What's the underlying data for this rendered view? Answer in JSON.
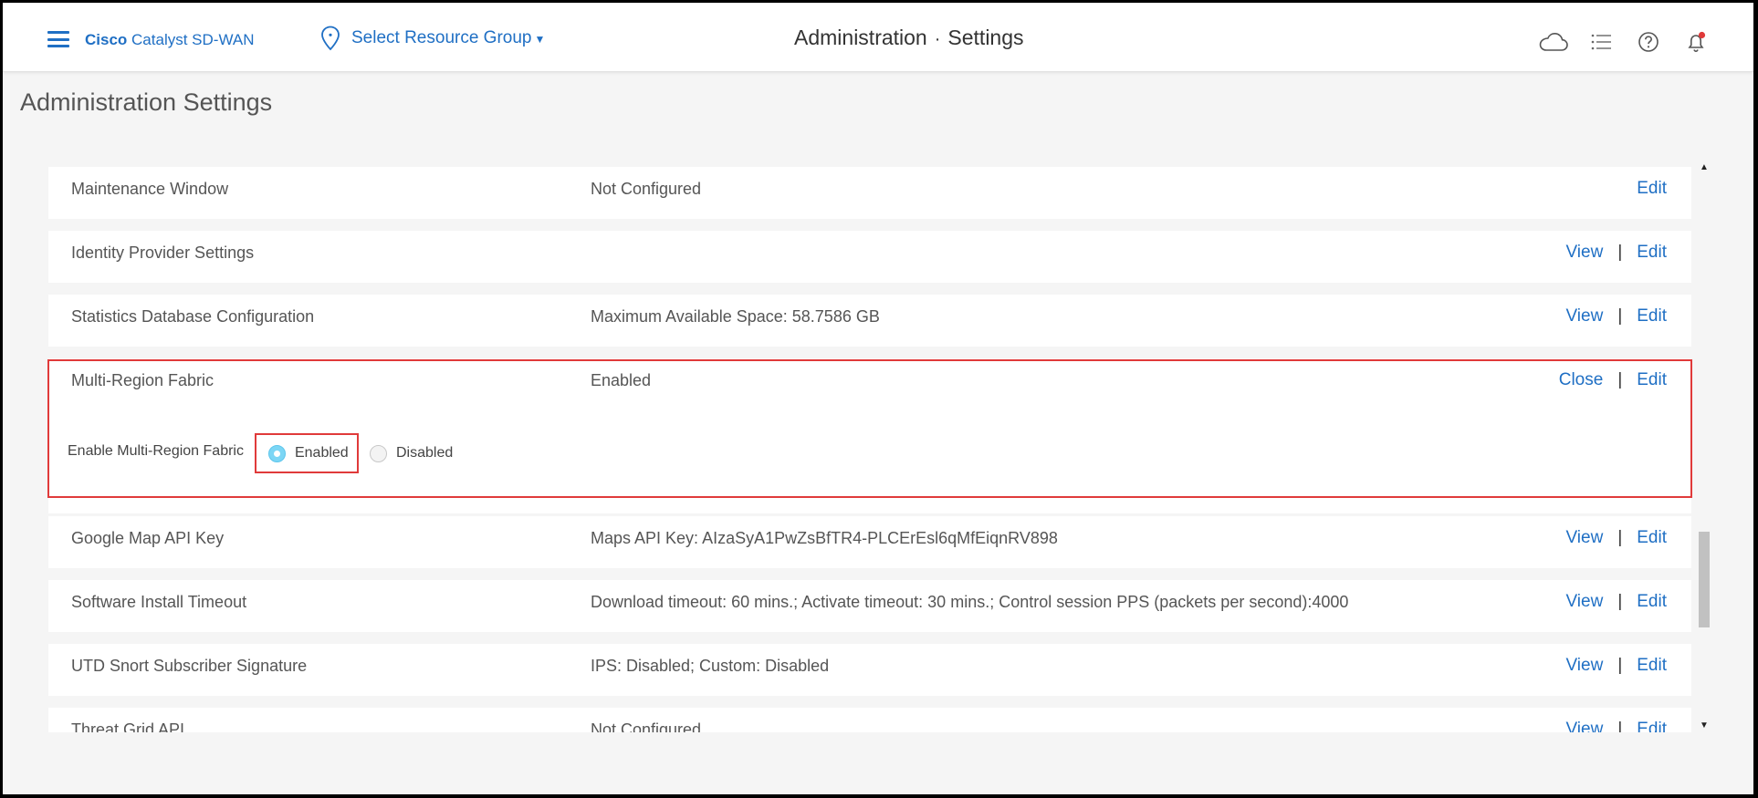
{
  "header": {
    "brand_bold": "Cisco",
    "brand_rest": "Catalyst SD-WAN",
    "resource_group": "Select Resource Group",
    "section": "Administration",
    "subsection": "Settings",
    "separator": "·",
    "icons": [
      "menu-icon",
      "location-pin-icon",
      "cloud-icon",
      "task-list-icon",
      "help-icon",
      "notification-bell-icon"
    ],
    "accent_color": "#1f6fc4",
    "notification_dot_color": "#e03a3a"
  },
  "page": {
    "title": "Administration Settings"
  },
  "settings": [
    {
      "name": "Maintenance Window",
      "value": "Not Configured",
      "actions": [
        "Edit"
      ]
    },
    {
      "name": "Identity Provider Settings",
      "value": "",
      "actions": [
        "View",
        "Edit"
      ]
    },
    {
      "name": "Statistics Database Configuration",
      "value": "Maximum Available Space: 58.7586 GB",
      "actions": [
        "View",
        "Edit"
      ]
    },
    {
      "name": "Multi-Region Fabric",
      "value": "Enabled",
      "actions": [
        "Close",
        "Edit"
      ],
      "expanded": {
        "option_label": "Enable Multi-Region Fabric",
        "options": [
          "Enabled",
          "Disabled"
        ],
        "selected": "Enabled"
      }
    },
    {
      "name": "Google Map API Key",
      "value": "Maps API Key: AIzaSyA1PwZsBfTR4-PLCErEsl6qMfEiqnRV898",
      "actions": [
        "View",
        "Edit"
      ]
    },
    {
      "name": "Software Install Timeout",
      "value": "Download timeout: 60 mins.; Activate timeout: 30 mins.; Control session PPS (packets per second):4000",
      "actions": [
        "View",
        "Edit"
      ]
    },
    {
      "name": "UTD Snort Subscriber Signature",
      "value": "IPS: Disabled; Custom: Disabled",
      "actions": [
        "View",
        "Edit"
      ]
    },
    {
      "name": "Threat Grid API",
      "value": "Not Configured",
      "actions": [
        "View",
        "Edit"
      ]
    }
  ],
  "ui": {
    "action_separator": "|",
    "highlight_color": "#e03a3a",
    "scroll_up": "▲",
    "scroll_down": "▼"
  }
}
